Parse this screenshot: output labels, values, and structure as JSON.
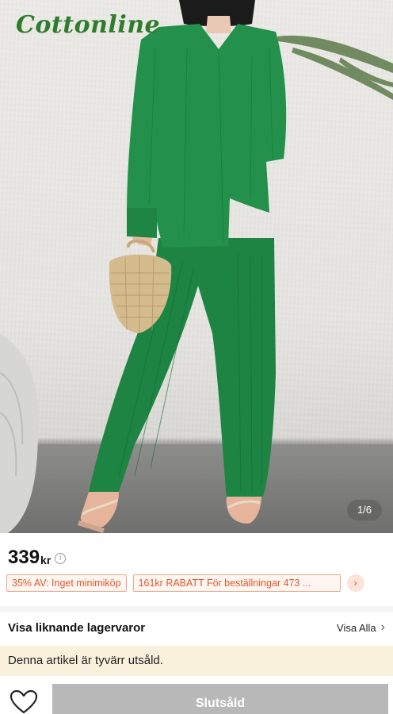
{
  "product": {
    "brand_logo": "Cottonline",
    "photo_counter": "1/6",
    "price": {
      "value": "339",
      "currency": "kr"
    },
    "info_icon": "info-icon"
  },
  "coupons": [
    {
      "label": "35% AV: Inget minimiköp"
    },
    {
      "label": "161kr RABATT För beställningar 473 ..."
    }
  ],
  "coupon_arrow": "›",
  "similar": {
    "title": "Visa liknande lagervaror",
    "see_all": "Visa Alla",
    "chevron": "›"
  },
  "notice": {
    "sold_out_text": "Denna artikel är tyvärr utsåld."
  },
  "actions": {
    "wishlist_icon": "heart-icon",
    "sold_out_button": "Slutsåld"
  },
  "colors": {
    "brand_green": "#2f7d2c",
    "garment_green": "#1f8a45",
    "coupon_orange": "#e0572d",
    "banner_bg": "#faf1dc",
    "disabled_button": "#b8b8b8"
  }
}
